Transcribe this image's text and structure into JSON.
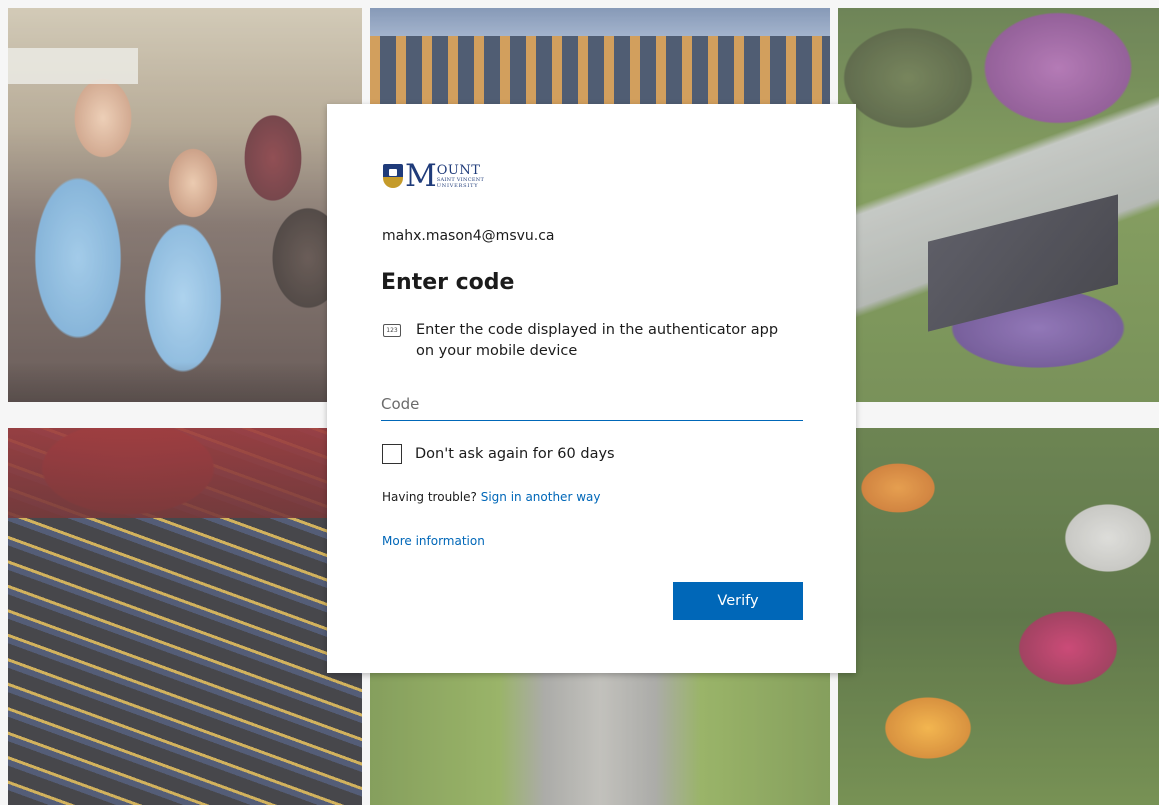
{
  "branding": {
    "logo_letter": "M",
    "logo_word": "OUNT",
    "logo_line2": "SAINT VINCENT",
    "logo_line3": "UNIVERSITY",
    "brand_color": "#1f3b7a"
  },
  "signin": {
    "email": "mahx.mason4@msvu.ca",
    "title": "Enter code",
    "instruction_icon": "123",
    "instruction": "Enter the code displayed in the authenticator app on your mobile device",
    "code_placeholder": "Code",
    "code_value": "",
    "remember_label": "Don't ask again for 60 days",
    "remember_checked": false,
    "trouble_prefix": "Having trouble?",
    "trouble_link": "Sign in another way",
    "more_info": "More information",
    "verify_label": "Verify"
  },
  "colors": {
    "accent": "#0067b8",
    "text": "#1b1b1b"
  }
}
